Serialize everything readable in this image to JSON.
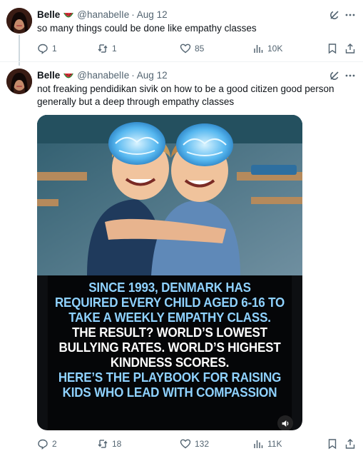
{
  "accent_colors": {
    "caption_blue": "#8fd2ff",
    "caption_white": "#ffffff",
    "muted": "#536471"
  },
  "tweets": [
    {
      "name": "Belle",
      "emoji": "watermelon-icon",
      "handle": "@hanabelIe",
      "separator": "·",
      "date": "Aug 12",
      "text": "so many things could be done like empathy classes",
      "stats": {
        "replies": "1",
        "reposts": "1",
        "likes": "85",
        "views": "10K"
      }
    },
    {
      "name": "Belle",
      "emoji": "watermelon-icon",
      "handle": "@hanabelIe",
      "separator": "·",
      "date": "Aug 12",
      "text": "not freaking pendidikan sivik on how to be a good citizen good person generally but a deep through empathy classes",
      "media": {
        "caption_lines": [
          {
            "text": "SINCE 1993, DENMARK HAS",
            "color": "blue"
          },
          {
            "text": "REQUIRED EVERY CHILD AGED 6-16 TO",
            "color": "blue"
          },
          {
            "text": "TAKE A WEEKLY EMPATHY CLASS.",
            "color": "blue"
          },
          {
            "text": "THE RESULT? WORLD’S LOWEST",
            "color": "white"
          },
          {
            "text": "BULLYING RATES. WORLD’S HIGHEST",
            "color": "white"
          },
          {
            "text": "KINDNESS SCORES.",
            "color": "white"
          },
          {
            "text": "HERE’S THE PLAYBOOK FOR RAISING",
            "color": "blue"
          },
          {
            "text": "KIDS WHO LEAD WITH COMPASSION",
            "color": "blue"
          }
        ]
      },
      "stats": {
        "replies": "2",
        "reposts": "18",
        "likes": "132",
        "views": "11K"
      }
    }
  ]
}
